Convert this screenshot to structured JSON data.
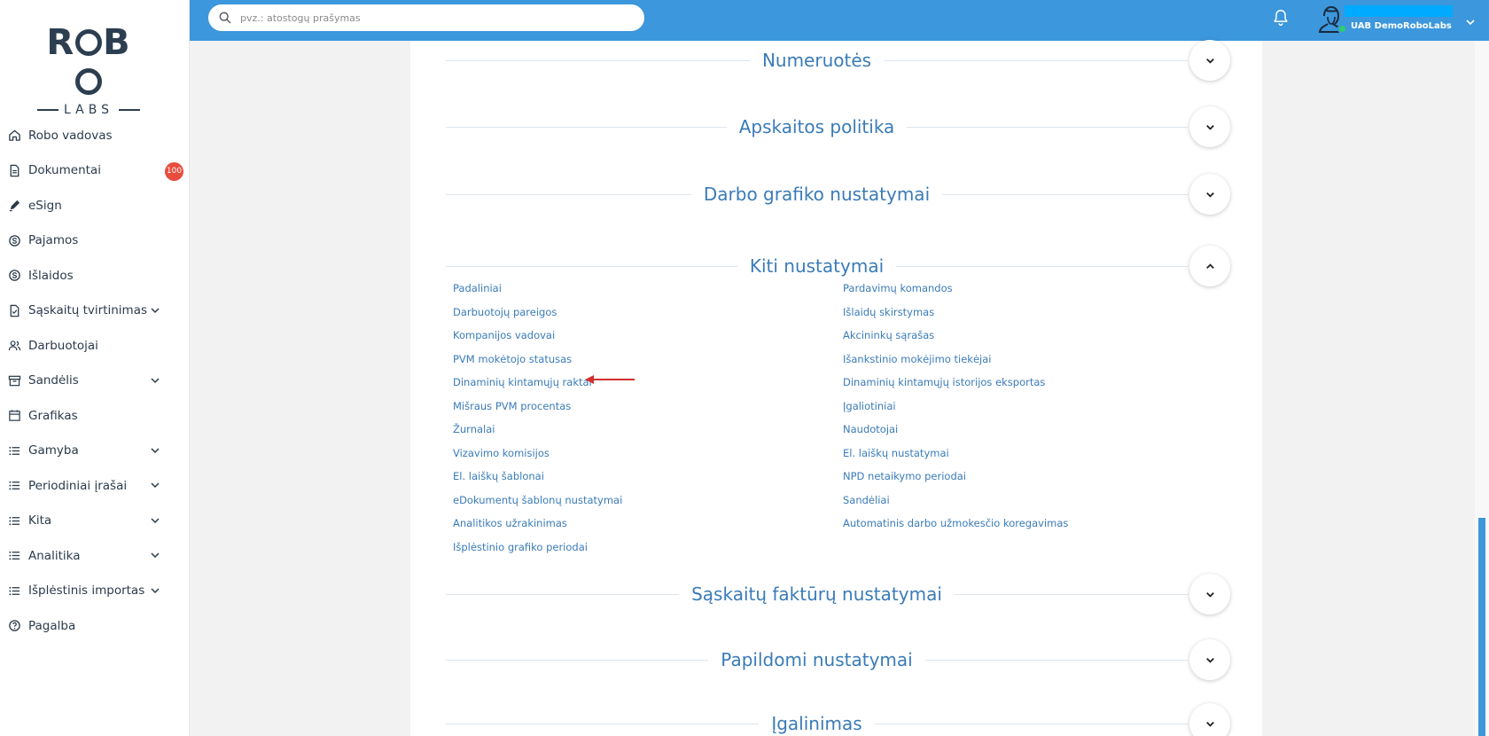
{
  "logo": {
    "top": "ROBO",
    "bottom": "LABS"
  },
  "sidebar": {
    "items": [
      {
        "label": "Robo vadovas",
        "icon": "home-icon",
        "chevron": false
      },
      {
        "label": "Dokumentai",
        "icon": "document-icon",
        "chevron": false,
        "badge": "100"
      },
      {
        "label": "eSign",
        "icon": "pen-icon",
        "chevron": false
      },
      {
        "label": "Pajamos",
        "icon": "income-icon",
        "chevron": false
      },
      {
        "label": "Išlaidos",
        "icon": "expense-icon",
        "chevron": false
      },
      {
        "label": "Sąskaitų tvirtinimas",
        "icon": "invoice-check-icon",
        "chevron": true
      },
      {
        "label": "Darbuotojai",
        "icon": "users-icon",
        "chevron": false
      },
      {
        "label": "Sandėlis",
        "icon": "archive-icon",
        "chevron": true
      },
      {
        "label": "Grafikas",
        "icon": "calendar-icon",
        "chevron": false
      },
      {
        "label": "Gamyba",
        "icon": "list-icon",
        "chevron": true
      },
      {
        "label": "Periodiniai įrašai",
        "icon": "list-icon",
        "chevron": true
      },
      {
        "label": "Kita",
        "icon": "list-icon",
        "chevron": true
      },
      {
        "label": "Analitika",
        "icon": "list-icon",
        "chevron": true
      },
      {
        "label": "Išplėstinis importas",
        "icon": "list-icon",
        "chevron": true
      },
      {
        "label": "Pagalba",
        "icon": "help-icon",
        "chevron": false
      }
    ]
  },
  "topbar": {
    "search_placeholder": "pvz.: atostogų prašymas",
    "company": "UAB DemoRoboLabs",
    "accent": "#3c97dc"
  },
  "sections": {
    "numeruotes": "Numeruotės",
    "apskaitos": "Apskaitos politika",
    "darbo": "Darbo grafiko nustatymai",
    "kiti": "Kiti nustatymai",
    "saskaitu": "Sąskaitų faktūrų nustatymai",
    "papildomi": "Papildomi nustatymai",
    "igalinimas": "Įgalinimas"
  },
  "kiti_links": {
    "left": [
      "Padaliniai",
      "Darbuotojų pareigos",
      "Kompanijos vadovai",
      "PVM mokėtojo statusas",
      "Dinaminių kintamųjų raktai",
      "Mišraus PVM procentas",
      "Žurnalai",
      "Vizavimo komisijos",
      "El. laiškų šablonai",
      "eDokumentų šablonų nustatymai",
      "Analitikos užrakinimas",
      "Išplėstinio grafiko periodai"
    ],
    "right": [
      "Pardavimų komandos",
      "Išlaidų skirstymas",
      "Akcininkų sąrašas",
      "Išankstinio mokėjimo tiekėjai",
      "Dinaminių kintamųjų istorijos eksportas",
      "Įgaliotiniai",
      "Naudotojai",
      "El. laiškų nustatymai",
      "NPD netaikymo periodai",
      "Sandėliai",
      "Automatinis darbo užmokesčio koregavimas"
    ]
  }
}
